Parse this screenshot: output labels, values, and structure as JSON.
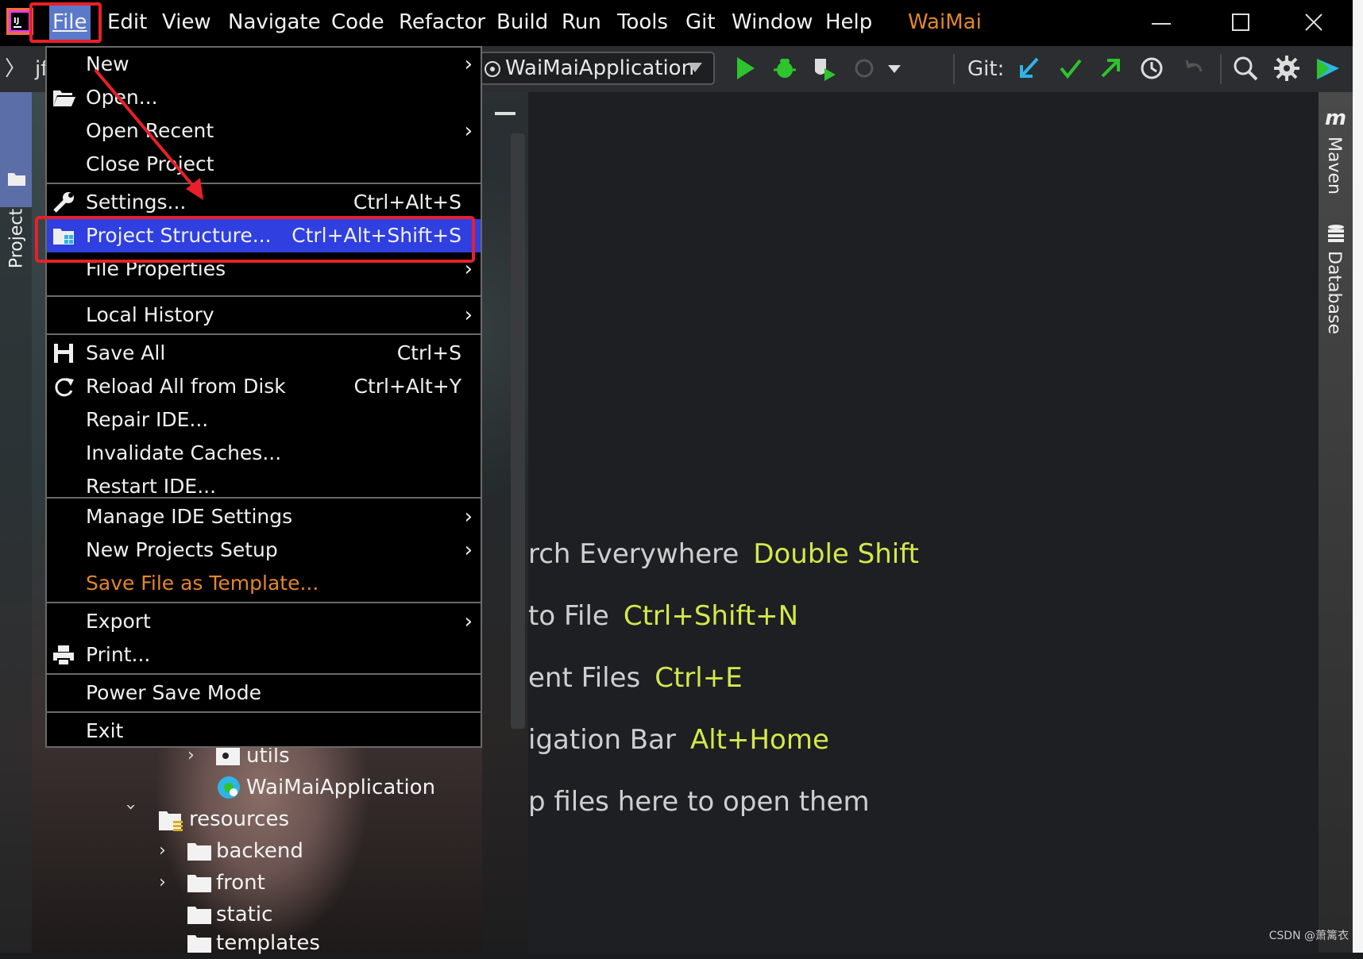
{
  "menubar": {
    "items": [
      {
        "label": "File"
      },
      {
        "label": "Edit"
      },
      {
        "label": "View"
      },
      {
        "label": "Navigate"
      },
      {
        "label": "Code"
      },
      {
        "label": "Refactor"
      },
      {
        "label": "Build"
      },
      {
        "label": "Run"
      },
      {
        "label": "Tools"
      },
      {
        "label": "Git"
      },
      {
        "label": "Window"
      },
      {
        "label": "Help"
      }
    ],
    "project_title": "WaiMai"
  },
  "toolbar": {
    "breadcrumb": "jf",
    "run_config": "WaiMaiApplication",
    "git_label": "Git:"
  },
  "sidebars": {
    "left_tab": "Project",
    "right_tabs": [
      "Maven",
      "Database"
    ]
  },
  "file_menu": {
    "items": [
      {
        "label": "New",
        "shortcut": "",
        "submenu": true
      },
      {
        "label": "Open...",
        "shortcut": "",
        "submenu": false
      },
      {
        "label": "Open Recent",
        "shortcut": "",
        "submenu": true
      },
      {
        "label": "Close Project",
        "shortcut": "",
        "submenu": false
      },
      {
        "label": "Settings...",
        "shortcut": "Ctrl+Alt+S",
        "submenu": false
      },
      {
        "label": "Project Structure...",
        "shortcut": "Ctrl+Alt+Shift+S",
        "submenu": false
      },
      {
        "label": "File Properties",
        "shortcut": "",
        "submenu": true
      },
      {
        "label": "Local History",
        "shortcut": "",
        "submenu": true
      },
      {
        "label": "Save All",
        "shortcut": "Ctrl+S",
        "submenu": false
      },
      {
        "label": "Reload All from Disk",
        "shortcut": "Ctrl+Alt+Y",
        "submenu": false
      },
      {
        "label": "Repair IDE...",
        "shortcut": "",
        "submenu": false
      },
      {
        "label": "Invalidate Caches...",
        "shortcut": "",
        "submenu": false
      },
      {
        "label": "Restart IDE...",
        "shortcut": "",
        "submenu": false
      },
      {
        "label": "Manage IDE Settings",
        "shortcut": "",
        "submenu": true
      },
      {
        "label": "New Projects Setup",
        "shortcut": "",
        "submenu": true
      },
      {
        "label": "Save File as Template...",
        "shortcut": "",
        "submenu": false
      },
      {
        "label": "Export",
        "shortcut": "",
        "submenu": true
      },
      {
        "label": "Print...",
        "shortcut": "",
        "submenu": false
      },
      {
        "label": "Power Save Mode",
        "shortcut": "",
        "submenu": false
      },
      {
        "label": "Exit",
        "shortcut": "",
        "submenu": false
      }
    ]
  },
  "project_tree": {
    "rows": [
      {
        "label": "utils"
      },
      {
        "label": "WaiMaiApplication"
      },
      {
        "label": "resources"
      },
      {
        "label": "backend"
      },
      {
        "label": "front"
      },
      {
        "label": "static"
      },
      {
        "label": "templates"
      }
    ]
  },
  "editor_hints": [
    {
      "text": "rch Everywhere",
      "key": "Double Shift"
    },
    {
      "text": "to File",
      "key": "Ctrl+Shift+N"
    },
    {
      "text": "ent Files",
      "key": "Ctrl+E"
    },
    {
      "text": "igation Bar",
      "key": "Alt+Home"
    },
    {
      "text": "p files here to open them",
      "key": ""
    }
  ],
  "watermark": "CSDN @萧篱衣",
  "colors": {
    "accent_highlight": "#2f3fe0",
    "annotation_red": "#e8202a",
    "title_orange": "#e2862b",
    "hint_key_yellow": "#d4e84a"
  }
}
